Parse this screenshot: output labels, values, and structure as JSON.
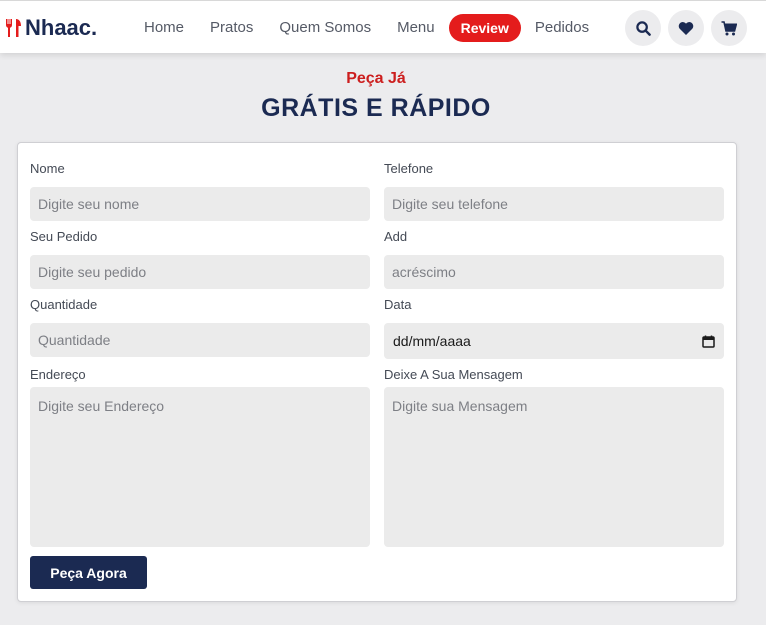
{
  "header": {
    "logo": "Nhaac.",
    "nav": [
      "Home",
      "Pratos",
      "Quem Somos",
      "Menu",
      "Review",
      "Pedidos"
    ],
    "active_nav": "Review",
    "icons": [
      "search-icon",
      "heart-icon",
      "cart-icon"
    ]
  },
  "heading": {
    "subtitle": "Peça Já",
    "title": "GRÁTIS E RÁPIDO"
  },
  "form": {
    "nome": {
      "label": "Nome",
      "placeholder": "Digite seu nome"
    },
    "telefone": {
      "label": "Telefone",
      "placeholder": "Digite seu telefone"
    },
    "pedido": {
      "label": "Seu Pedido",
      "placeholder": "Digite seu pedido"
    },
    "add": {
      "label": "Add",
      "placeholder": "acréscimo"
    },
    "quantidade": {
      "label": "Quantidade",
      "placeholder": "Quantidade"
    },
    "data": {
      "label": "Data",
      "value": "dd/mm/aaaa"
    },
    "endereco": {
      "label": "Endereço",
      "placeholder": "Digite seu Endereço"
    },
    "mensagem": {
      "label": "Deixe A Sua Mensagem",
      "placeholder": "Digite sua Mensagem"
    },
    "submit": "Peça Agora"
  },
  "colors": {
    "brand": "#1b2a52",
    "accent": "#e41c1c"
  }
}
